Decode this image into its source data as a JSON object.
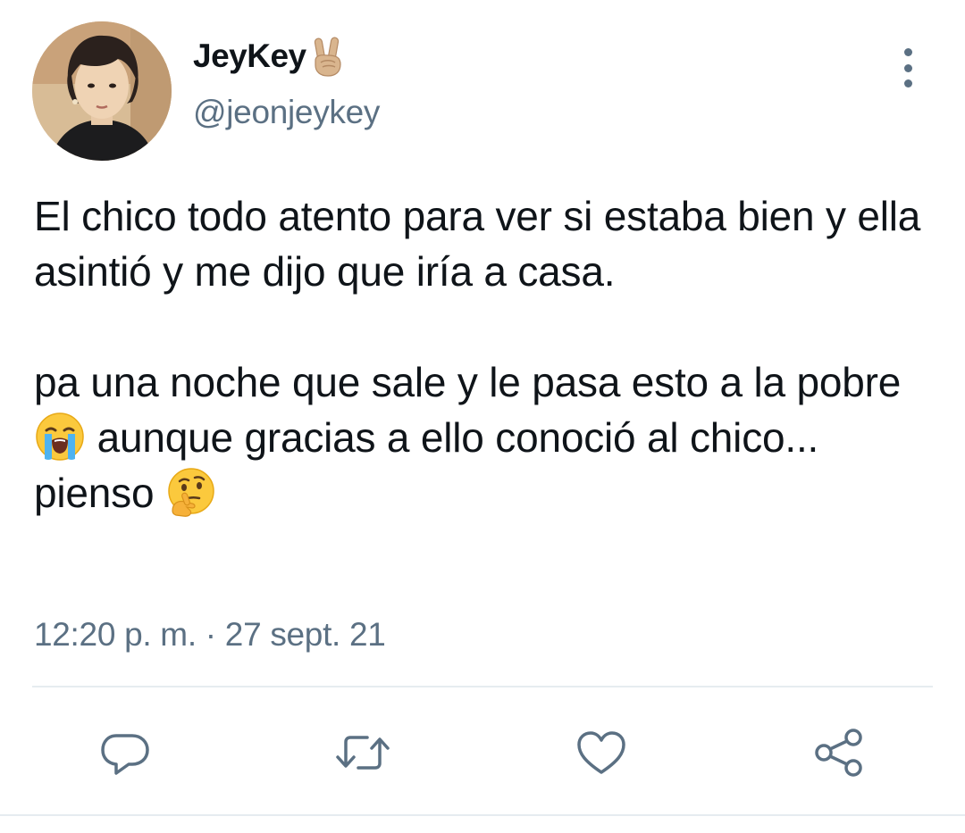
{
  "user": {
    "display_name": "JeyKey",
    "name_emoji": "victory-hand-emoji",
    "handle": "@jeonjeykey"
  },
  "tweet": {
    "paragraph_1": "El chico todo atento para ver si estaba bien y ella asintió y me dijo que iría a casa.",
    "paragraph_2_part_1": "pa una noche que sale y le pasa esto a la pobre ",
    "paragraph_2_emoji_1": "loudly-crying-face-emoji",
    "paragraph_2_part_2": " aunque gracias a ello conoció al chico... pienso ",
    "paragraph_2_emoji_2": "thinking-face-emoji",
    "timestamp": "12:20 p. m. · 27 sept. 21"
  },
  "actions": {
    "reply": "reply-icon",
    "retweet": "retweet-icon",
    "like": "heart-icon",
    "share": "share-icon"
  },
  "colors": {
    "text_primary": "#0f1419",
    "text_secondary": "#5b7083",
    "divider": "#e6ecf0"
  }
}
